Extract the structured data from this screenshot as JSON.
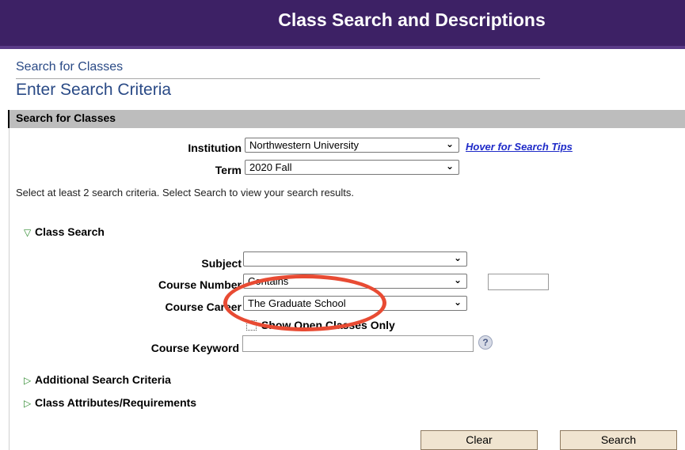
{
  "header": {
    "title": "Class Search and Descriptions"
  },
  "breadcrumb": "Search for Classes",
  "page_heading": "Enter Search Criteria",
  "section": {
    "title": "Search for Classes"
  },
  "institution": {
    "label": "Institution",
    "value": "Northwestern University"
  },
  "hover_tip": "Hover for Search Tips",
  "term": {
    "label": "Term",
    "value": "2020 Fall"
  },
  "instructions": "Select at least 2 search criteria. Select Search to view your search results.",
  "class_search": {
    "title": "Class Search",
    "subject": {
      "label": "Subject",
      "value": ""
    },
    "course_number": {
      "label": "Course Number",
      "operator": "Contains",
      "value": ""
    },
    "course_career": {
      "label": "Course Career",
      "value": "The Graduate School"
    },
    "open_only": {
      "label": "Show Open Classes Only",
      "checked": false
    },
    "keyword": {
      "label": "Course Keyword",
      "value": ""
    }
  },
  "additional_criteria": "Additional Search Criteria",
  "class_attributes": "Class Attributes/Requirements",
  "buttons": {
    "clear": "Clear",
    "search": "Search"
  },
  "colors": {
    "header_bg": "#3d2165",
    "link": "#1e2ac8",
    "annotation": "#e84b33",
    "disclosure": "#2f8a2f"
  },
  "icons": {
    "dropdown": "chevron-down-icon",
    "help": "help-icon",
    "expanded": "triangle-down-icon",
    "collapsed": "triangle-right-icon"
  }
}
